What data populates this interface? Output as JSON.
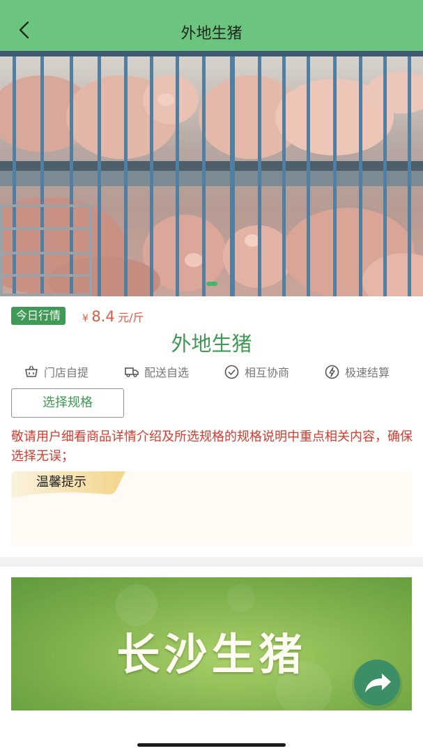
{
  "header": {
    "title": "外地生猪"
  },
  "product": {
    "badge": "今日行情",
    "currency": "¥",
    "price": "8.4",
    "unit": "元/斤",
    "name": "外地生猪"
  },
  "services": [
    {
      "label": "门店自提",
      "icon": "basket-icon"
    },
    {
      "label": "配送自选",
      "icon": "truck-icon"
    },
    {
      "label": "相互协商",
      "icon": "check-circle-icon"
    },
    {
      "label": "极速结算",
      "icon": "lightning-icon"
    }
  ],
  "spec_button": "选择规格",
  "notice": "敬请用户细看商品详情介绍及所选规格的规格说明中重点相关内容，确保选择无误；",
  "tip": {
    "title": "温馨提示"
  },
  "banner": {
    "text": "长沙生猪"
  },
  "colors": {
    "header": "#6cc57e",
    "accent_green": "#3e9a54",
    "price_red": "#e05a43",
    "notice_red": "#d63b2e"
  }
}
